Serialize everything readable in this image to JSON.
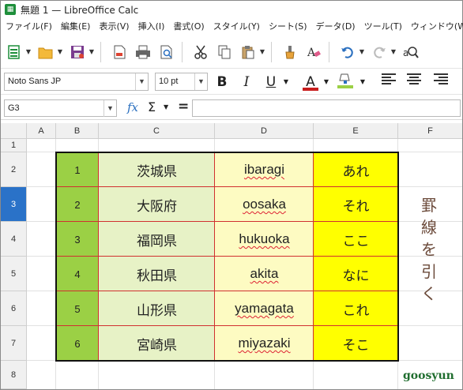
{
  "window": {
    "title": "無題 1 — LibreOffice Calc",
    "app_icon": "calc-icon"
  },
  "menu": [
    "ファイル(F)",
    "編集(E)",
    "表示(V)",
    "挿入(I)",
    "書式(O)",
    "スタイル(Y)",
    "シート(S)",
    "データ(D)",
    "ツール(T)",
    "ウィンドウ(W)"
  ],
  "toolbar": {
    "icons": [
      "new-icon",
      "open-icon",
      "save-icon",
      "export-pdf-icon",
      "print-icon",
      "print-preview-icon",
      "cut-icon",
      "copy-icon",
      "paste-icon",
      "clone-formatting-icon",
      "clear-formatting-icon",
      "undo-icon",
      "redo-icon",
      "find-replace-icon"
    ]
  },
  "format_bar": {
    "font_name": "Noto Sans JP",
    "font_size": "10 pt",
    "bold": "B",
    "italic": "I",
    "underline": "U",
    "font_color_label": "A",
    "font_color": "#c81e1e",
    "highlight_color": "#9bd045"
  },
  "formula_bar": {
    "cell_ref": "G3",
    "fx": "fx",
    "sigma": "Σ",
    "equals": "=",
    "content": ""
  },
  "columns": [
    "A",
    "B",
    "C",
    "D",
    "E",
    "F"
  ],
  "rows": [
    "1",
    "2",
    "3",
    "4",
    "5",
    "6",
    "7",
    "8"
  ],
  "active_row": "3",
  "table": {
    "rows": [
      {
        "num": "1",
        "kanji": "茨城県",
        "romaji": "ibaragi",
        "kana": "あれ"
      },
      {
        "num": "2",
        "kanji": "大阪府",
        "romaji": "oosaka",
        "kana": "それ"
      },
      {
        "num": "3",
        "kanji": "福岡県",
        "romaji": "hukuoka",
        "kana": "ここ"
      },
      {
        "num": "4",
        "kanji": "秋田県",
        "romaji": "akita",
        "kana": "なに"
      },
      {
        "num": "5",
        "kanji": "山形県",
        "romaji": "yamagata",
        "kana": "これ"
      },
      {
        "num": "6",
        "kanji": "宮崎県",
        "romaji": "miyazaki",
        "kana": "そこ"
      }
    ],
    "colors": {
      "col_b": "#9bd045",
      "col_c": "#e7f2c6",
      "col_d": "#fdfbc2",
      "col_e": "#ffff00",
      "inner_border": "#d03030",
      "outer_border": "#111111"
    }
  },
  "annotation": {
    "vertical_text": [
      "罫",
      "線",
      "を",
      "引",
      "く"
    ]
  },
  "watermark": "goosyun"
}
